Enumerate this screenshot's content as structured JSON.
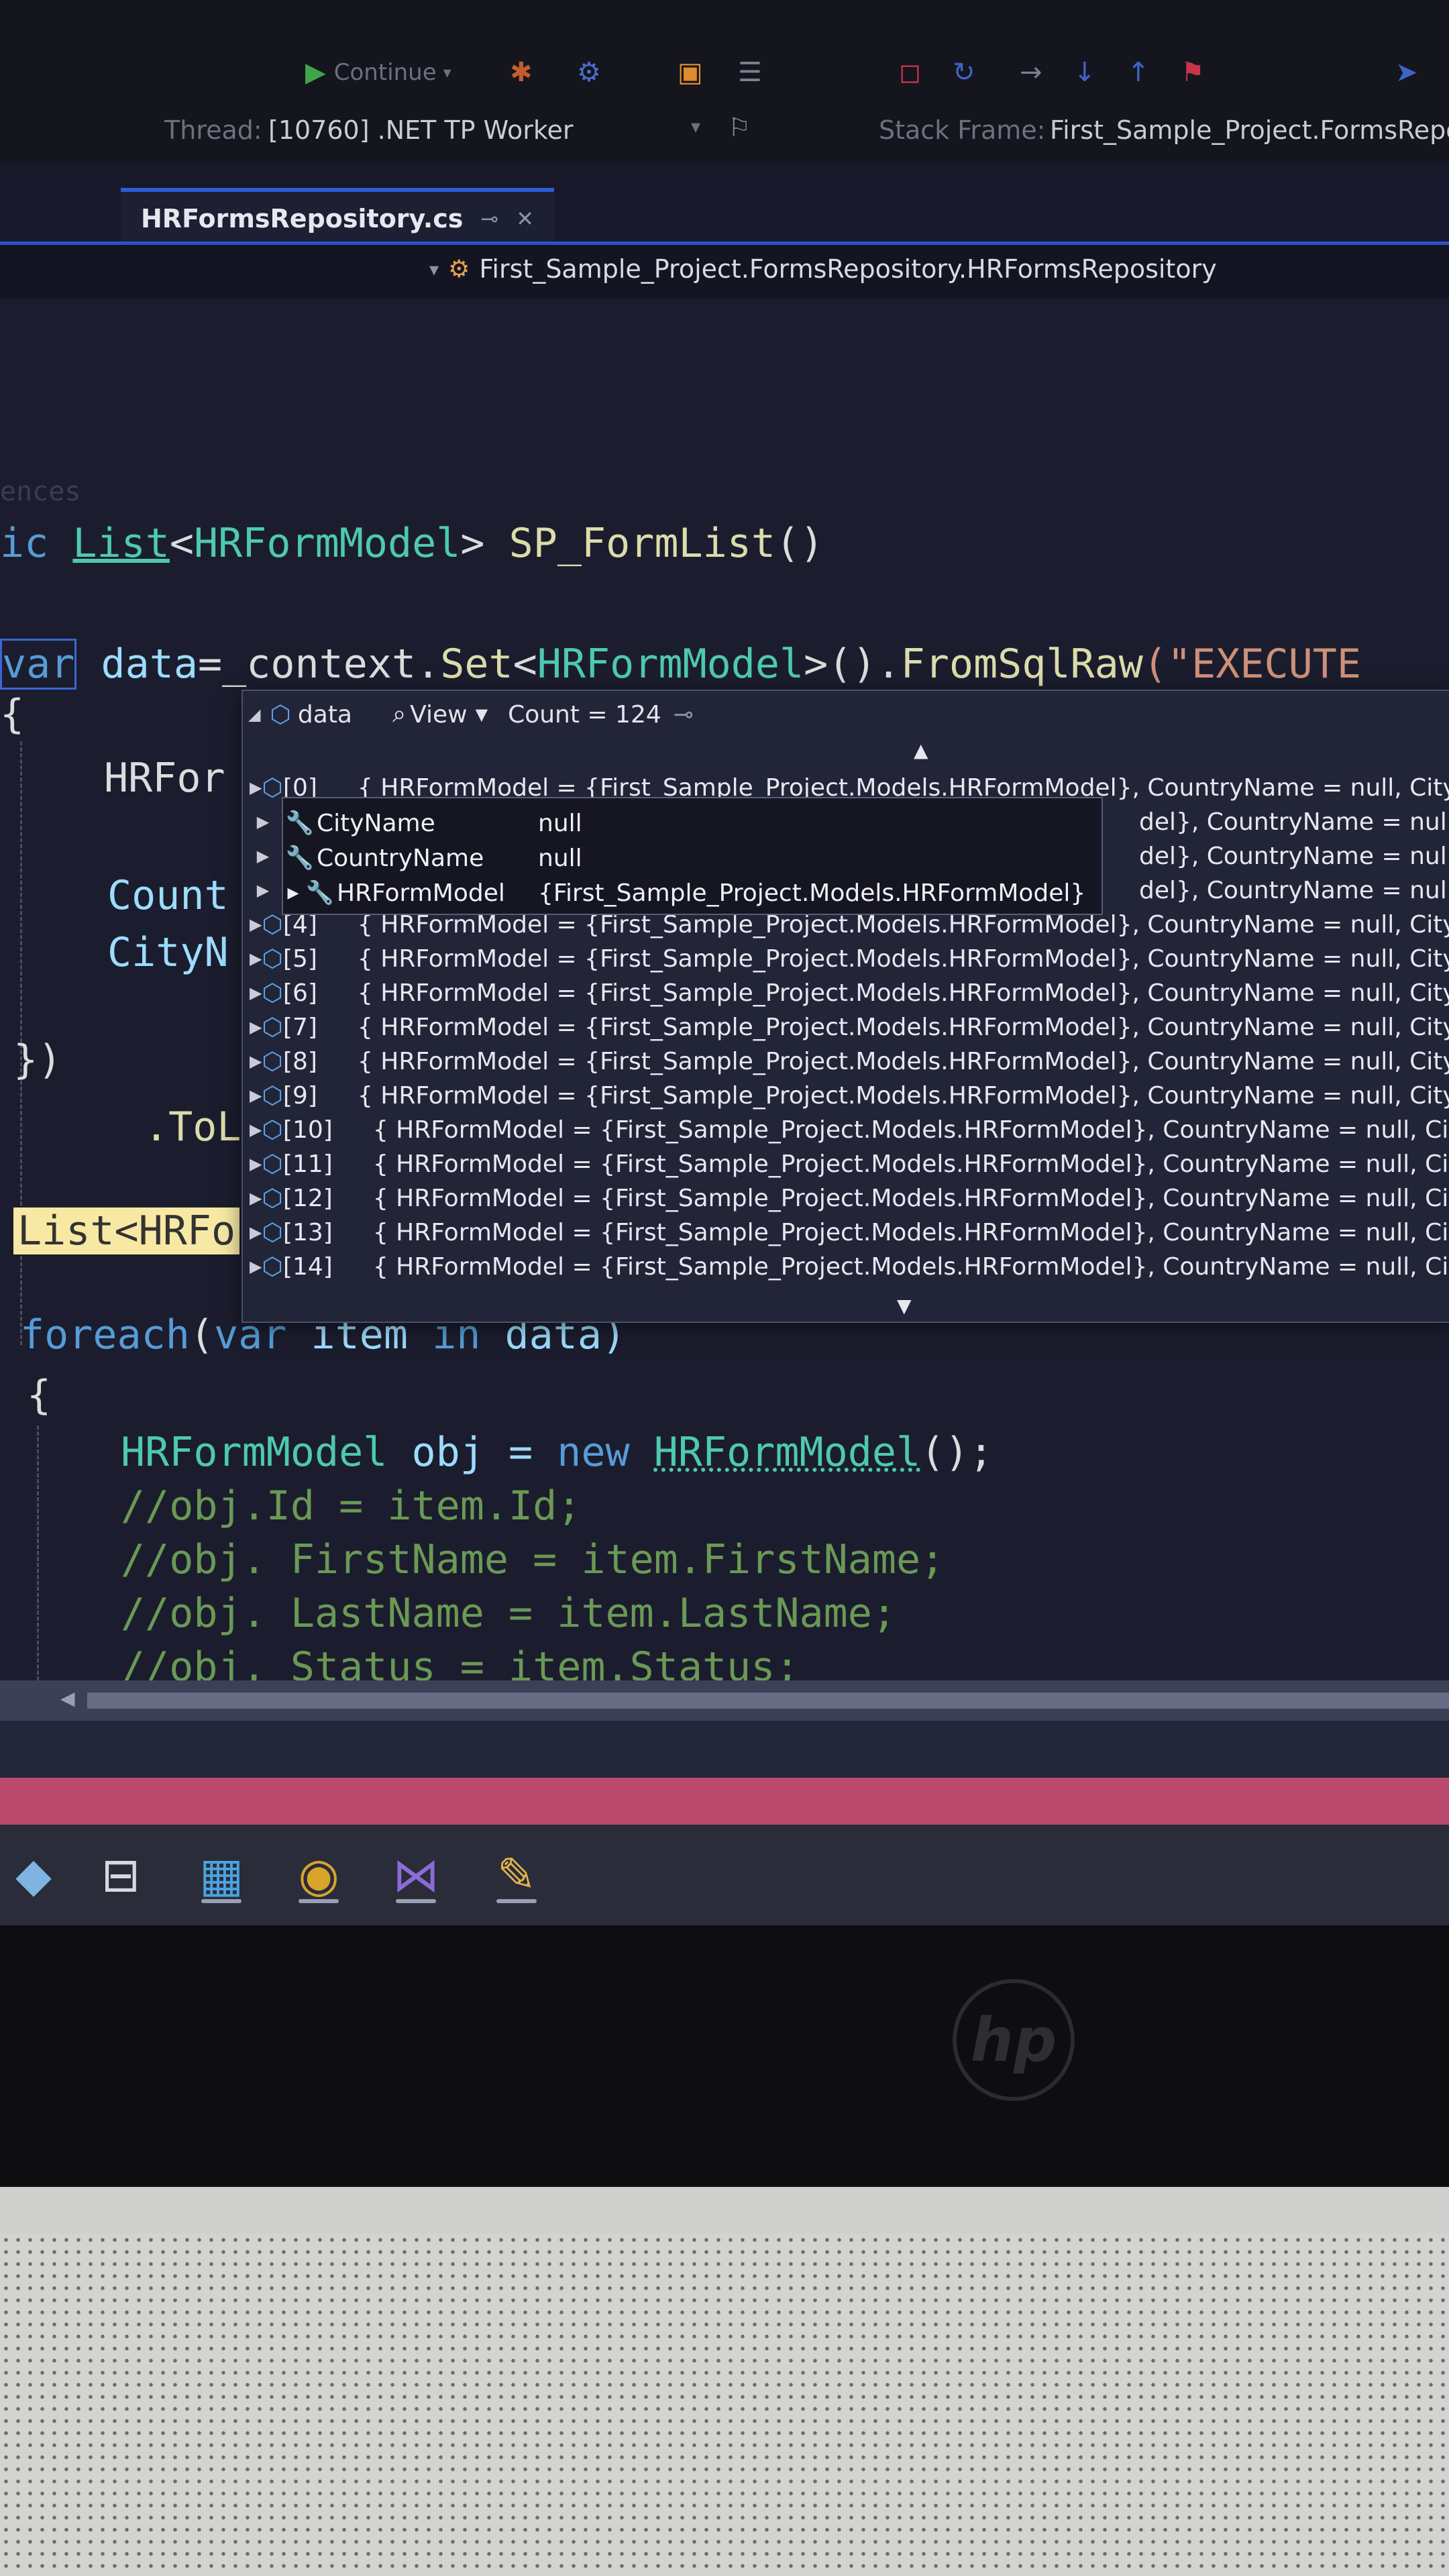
{
  "toolbar": {
    "continue_label": "Continue",
    "thread_label": "Thread:",
    "thread_value": "[10760] .NET TP Worker",
    "stack_frame_label": "Stack Frame:",
    "stack_frame_value": "First_Sample_Project.FormsRepos"
  },
  "tab": {
    "file_name": "HRFormsRepository.cs",
    "pin_icon": "pin-icon",
    "close_icon": "close-icon"
  },
  "navbar": {
    "type_path": "First_Sample_Project.FormsRepository.HRFormsRepository"
  },
  "editor": {
    "faint_text": "ences",
    "line_signature": [
      "ic ",
      "List",
      "<",
      "HRFormModel",
      "> ",
      "SP_FormList",
      "()"
    ],
    "line_var": [
      "var",
      " data",
      "=_context.",
      "Set",
      "<",
      "HRFormModel",
      ">().",
      "FromSqlRaw",
      "(\"EXECUTE"
    ],
    "open_brace": "{",
    "line_hrfor": "HRFor",
    "line_count": "Count",
    "line_cityn": "CityN",
    "close_braces": "})",
    "line_tol": ".ToL",
    "line_list_highlight": "List<HRFo",
    "line_foreach": [
      "foreach",
      "(",
      "var",
      " item ",
      "in",
      " data)"
    ],
    "brace2": "{",
    "line_new": [
      "HRFormModel",
      " obj = ",
      "new",
      " ",
      "HRFormModel",
      "();"
    ],
    "comments": [
      "//obj.Id = item.Id;",
      "//obj. FirstName = item.FirstName;",
      "//obj. LastName = item.LastName;",
      "//obj. Status = item.Status;"
    ]
  },
  "datatip": {
    "variable": "data",
    "view_label": "View",
    "count_label": "Count = 124",
    "rows": [
      {
        "index": "[0]",
        "value": "{ HRFormModel = {First_Sample_Project.Models.HRFormModel}, CountryName = null, City"
      },
      {
        "index": "",
        "value": "del}, CountryName = null, City"
      },
      {
        "index": "",
        "value": "del}, CountryName = null, City"
      },
      {
        "index": "",
        "value": "del}, CountryName = null, City"
      },
      {
        "index": "[4]",
        "value": "{ HRFormModel = {First_Sample_Project.Models.HRFormModel}, CountryName = null, City"
      },
      {
        "index": "[5]",
        "value": "{ HRFormModel = {First_Sample_Project.Models.HRFormModel}, CountryName = null, City"
      },
      {
        "index": "[6]",
        "value": "{ HRFormModel = {First_Sample_Project.Models.HRFormModel}, CountryName = null, City"
      },
      {
        "index": "[7]",
        "value": "{ HRFormModel = {First_Sample_Project.Models.HRFormModel}, CountryName = null, CityN"
      },
      {
        "index": "[8]",
        "value": "{ HRFormModel = {First_Sample_Project.Models.HRFormModel}, CountryName = null, CityN"
      },
      {
        "index": "[9]",
        "value": "{ HRFormModel = {First_Sample_Project.Models.HRFormModel}, CountryName = null, CityN"
      },
      {
        "index": "[10]",
        "value": "{ HRFormModel = {First_Sample_Project.Models.HRFormModel}, CountryName = null, CityN"
      },
      {
        "index": "[11]",
        "value": "{ HRFormModel = {First_Sample_Project.Models.HRFormModel}, CountryName = null, CityN"
      },
      {
        "index": "[12]",
        "value": "{ HRFormModel = {First_Sample_Project.Models.HRFormModel}, CountryName = null, CityN"
      },
      {
        "index": "[13]",
        "value": "{ HRFormModel = {First_Sample_Project.Models.HRFormModel}, CountryName = null, CityN"
      },
      {
        "index": "[14]",
        "value": "{ HRFormModel = {First_Sample_Project.Models.HRFormModel}, CountryName = null, CityN"
      }
    ],
    "expanded": [
      {
        "name": "CityName",
        "value": "null"
      },
      {
        "name": "CountryName",
        "value": "null"
      },
      {
        "name": "HRFormModel",
        "value": "{First_Sample_Project.Models.HRFormModel}"
      }
    ]
  },
  "taskbar": {
    "items": [
      "task-view-icon",
      "store-icon",
      "chrome-icon",
      "visual-studio-icon",
      "paint-icon"
    ]
  },
  "laptop": {
    "logo": "hp"
  },
  "colors": {
    "editor_bg": "#1b1d2e",
    "keyword": "#569cd6",
    "type": "#4ec9b0",
    "method": "#dcdcaa",
    "string": "#ce9178",
    "comment": "#6a9955",
    "status_bar": "#b94a6e",
    "tab_accent": "#2f4fd1"
  }
}
